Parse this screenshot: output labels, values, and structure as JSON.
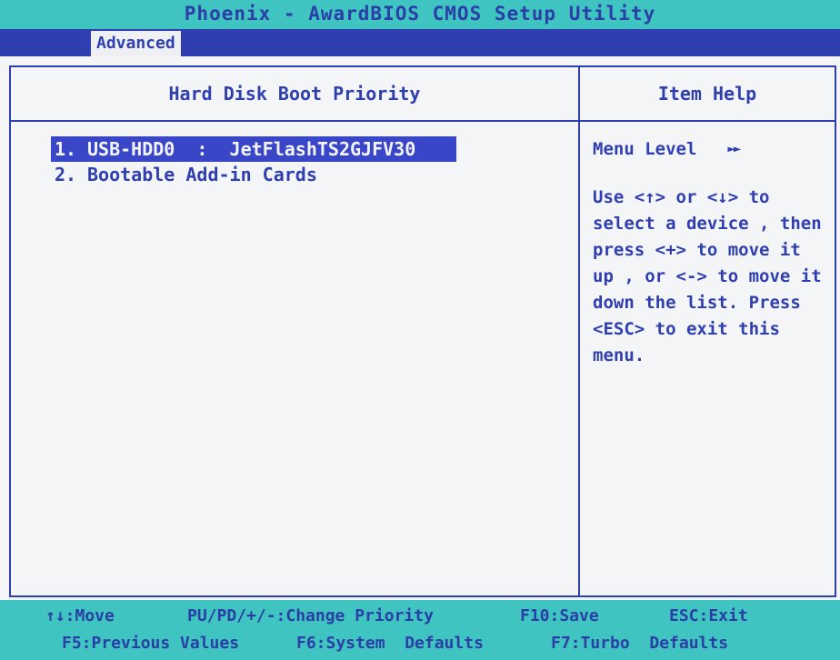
{
  "title": "Phoenix - AwardBIOS CMOS Setup Utility",
  "menu": {
    "active_tab": "Advanced"
  },
  "main": {
    "section_title": "Hard Disk Boot Priority",
    "boot_items": [
      {
        "number": "1.",
        "label": "USB-HDD0  :  JetFlashTS2GJFV30",
        "selected": true
      },
      {
        "number": "2.",
        "label": "Bootable Add-in Cards",
        "selected": false
      }
    ]
  },
  "help": {
    "title": "Item Help",
    "menu_level_label": "Menu Level",
    "menu_level_arrows": "►►",
    "text": "Use <↑> or <↓> to\nselect a device , then\npress <+> to move it\nup , or <-> to move it\ndown the list. Press\n<ESC> to exit this\nmenu."
  },
  "footer": {
    "move": "↑↓:Move",
    "change_priority": "PU/PD/+/-:Change Priority",
    "save": "F10:Save",
    "exit": "ESC:Exit",
    "previous_values": "F5:Previous Values",
    "system_defaults": "F6:System  Defaults",
    "turbo_defaults": "F7:Turbo  Defaults"
  },
  "colors": {
    "bios_blue": "#2f3fb0",
    "bios_cyan": "#3fc4c2",
    "background": "#f4f5f6"
  }
}
